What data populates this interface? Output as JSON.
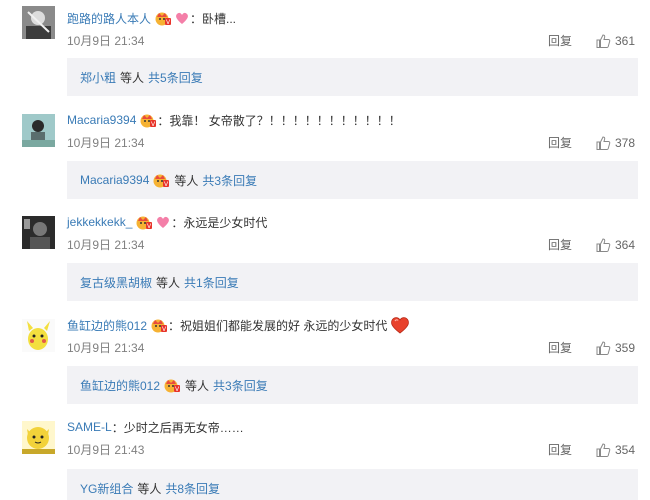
{
  "comments": [
    {
      "username": "跑路的路人本人",
      "badge_icon": "vip-crown-badge-icon",
      "extra_icon": "pink-heart-icon",
      "text": "：卧槽...",
      "time": "10月9日 21:34",
      "reply_label": "回复",
      "likes": "361",
      "sub": {
        "name": "郑小粗",
        "middle": "等人",
        "count": "共5条回复",
        "has_badge": false
      },
      "avatar_color": "#555555"
    },
    {
      "username": "Macaria9394",
      "badge_icon": "vip-crown-badge-icon",
      "extra_icon": "",
      "text": "：我靠！ 女帝散了？！！！！！！！！！！！",
      "time": "10月9日 21:34",
      "reply_label": "回复",
      "likes": "378",
      "sub": {
        "name": "Macaria9394",
        "middle": "等人",
        "count": "共3条回复",
        "has_badge": true
      },
      "avatar_color": "#6fa6a8"
    },
    {
      "username": "jekkekkekk_",
      "badge_icon": "vip-crown-badge-icon",
      "extra_icon": "pink-heart-icon",
      "text": "：永远是少女时代",
      "time": "10月9日 21:34",
      "reply_label": "回复",
      "likes": "364",
      "sub": {
        "name": "复古级黑胡椒",
        "middle": "等人",
        "count": "共1条回复",
        "has_badge": false
      },
      "avatar_color": "#3a3a3a"
    },
    {
      "username": "鱼缸边的熊012",
      "badge_icon": "vip-crown-badge-icon",
      "extra_icon": "",
      "text": "：祝姐姐们都能发展的好 永远的少女时代",
      "text_trailing_icon": "red-heart-icon",
      "time": "10月9日 21:34",
      "reply_label": "回复",
      "likes": "359",
      "sub": {
        "name": "鱼缸边的熊012",
        "middle": "等人",
        "count": "共3条回复",
        "has_badge": true
      },
      "avatar_color": "#f0e060"
    },
    {
      "username": "SAME-L",
      "badge_icon": "",
      "extra_icon": "",
      "text": "：少时之后再无女帝……",
      "time": "10月9日 21:43",
      "reply_label": "回复",
      "likes": "354",
      "sub": {
        "name": "YG新组合",
        "middle": "等人",
        "count": "共8条回复",
        "has_badge": false
      },
      "avatar_color": "#f2d23a"
    }
  ],
  "colors": {
    "username": "#3a7bb6",
    "subbox_bg": "#f2f2f5",
    "time": "#808080"
  }
}
